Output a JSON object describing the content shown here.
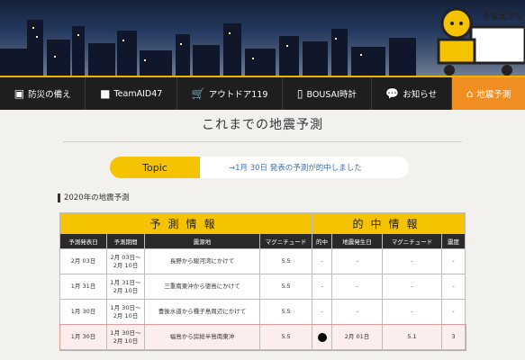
{
  "header": {
    "truck_label": "そなえアリ",
    "truck_badge": "防"
  },
  "nav": {
    "items": [
      {
        "icon": "first-aid-kit-icon",
        "glyph": "▣",
        "label": "防災の備え"
      },
      {
        "icon": "truck-icon",
        "glyph": "■",
        "label": "TeamAID47"
      },
      {
        "icon": "cart-icon",
        "glyph": "🛒",
        "label": "アウトドア119"
      },
      {
        "icon": "phone-icon",
        "glyph": "▯",
        "label": "BOUSAI時計"
      },
      {
        "icon": "chat-bubble-icon",
        "glyph": "💬",
        "label": "お知らせ"
      },
      {
        "icon": "broken-house-icon",
        "glyph": "⌂",
        "label": "地震予測"
      }
    ],
    "active_index": 5
  },
  "main": {
    "title": "これまでの地震予測",
    "topic": {
      "tag": "Topic",
      "text": "→1月 30日 発表の予測が的中しました"
    },
    "section_title": "2020年の地震予測"
  },
  "table": {
    "group_headers": [
      "予測情報",
      "的中情報"
    ],
    "columns": [
      "予測発表日",
      "予測期間",
      "震源地",
      "マグニチュード",
      "的中",
      "地震発生日",
      "マグニチュード",
      "震度"
    ],
    "rows": [
      {
        "announce": "2月 03日",
        "period": "2月 03日～\n2月 10日",
        "epicenter": "長野から駿河湾にかけて",
        "magnitude": "5.5",
        "hit": "-",
        "occur_date": "-",
        "actual_mag": "-",
        "intensity": "-"
      },
      {
        "announce": "1月 31日",
        "period": "1月 31日～\n2月 10日",
        "epicenter": "三重南東沖から徳島にかけて",
        "magnitude": "5.5",
        "hit": "-",
        "occur_date": "-",
        "actual_mag": "-",
        "intensity": "-"
      },
      {
        "announce": "1月 30日",
        "period": "1月 30日～\n2月 10日",
        "epicenter": "豊後水道から種子島周辺にかけて",
        "magnitude": "5.5",
        "hit": "-",
        "occur_date": "-",
        "actual_mag": "-",
        "intensity": "-"
      },
      {
        "announce": "1月 30日",
        "period": "1月 30日～\n2月 10日",
        "epicenter": "福島から房総半島南東沖",
        "magnitude": "5.5",
        "hit": "●",
        "occur_date": "2月 01日",
        "actual_mag": "5.1",
        "intensity": "3"
      }
    ]
  }
}
